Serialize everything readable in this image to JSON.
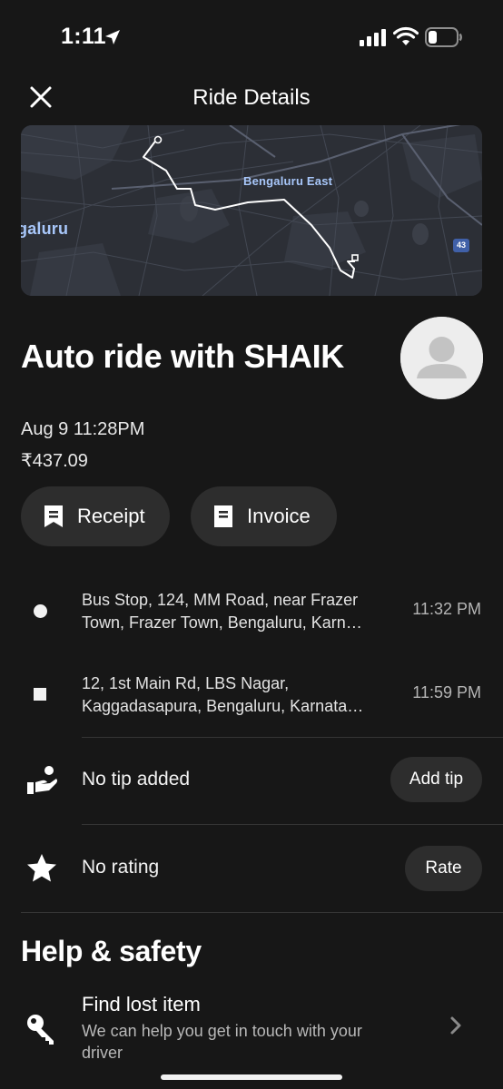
{
  "status_bar": {
    "time": "1:11"
  },
  "header": {
    "title": "Ride Details",
    "close_icon": "close-icon"
  },
  "map": {
    "label_east": "Bengaluru East",
    "label_city": "galuru",
    "road_shield": "43"
  },
  "ride": {
    "title": "Auto ride with SHAIK",
    "date": "Aug 9 11:28PM",
    "fare": "₹437.09",
    "receipt_label": "Receipt",
    "invoice_label": "Invoice"
  },
  "stops": [
    {
      "line1": "Bus Stop, 124, MM Road, near Frazer",
      "line2": "Town, Frazer Town, Bengaluru, Karn…",
      "time": "11:32 PM"
    },
    {
      "line1": "12, 1st Main Rd, LBS Nagar,",
      "line2": "Kaggadasapura, Bengaluru, Karnata…",
      "time": "11:59 PM"
    }
  ],
  "tip": {
    "label": "No tip added",
    "button": "Add tip",
    "icon": "hand-tip-icon"
  },
  "rating": {
    "label": "No rating",
    "button": "Rate",
    "icon": "star-icon"
  },
  "help": {
    "title": "Help & safety",
    "lost_item": {
      "title": "Find lost item",
      "subtitle": "We can help you get in touch with your driver",
      "icon": "key-icon"
    }
  },
  "colors": {
    "background": "#171717",
    "surface": "#2d2d2d",
    "text": "#f2f2f2",
    "map_bg": "#2c2f36",
    "map_label": "#a8c7fa"
  }
}
